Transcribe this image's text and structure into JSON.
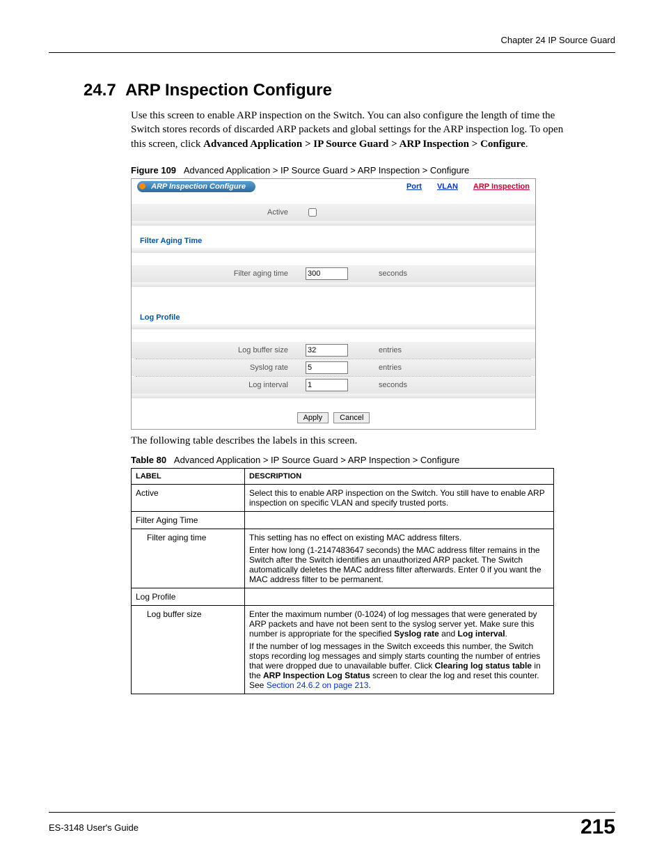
{
  "header": {
    "chapter": "Chapter 24 IP Source Guard"
  },
  "section": {
    "number": "24.7",
    "title": "ARP Inspection Configure",
    "intro_a": "Use this screen to enable ARP inspection on the Switch. You can also configure the length of time the Switch stores records of discarded ARP packets and global settings for the ARP inspection log. To open this screen, click ",
    "intro_bold": "Advanced Application > IP Source Guard > ARP Inspection > Configure",
    "intro_end": "."
  },
  "figure": {
    "label": "Figure 109",
    "caption": "Advanced Application > IP Source Guard > ARP Inspection > Configure"
  },
  "screenshot": {
    "title": "ARP Inspection Configure",
    "links": {
      "port": "Port",
      "vlan": "VLAN",
      "arp": "ARP Inspection"
    },
    "rows": {
      "active_label": "Active",
      "filter_section": "Filter Aging Time",
      "filter_aging_label": "Filter aging time",
      "filter_aging_value": "300",
      "filter_aging_unit": "seconds",
      "log_section": "Log Profile",
      "log_buffer_label": "Log buffer size",
      "log_buffer_value": "32",
      "log_buffer_unit": "entries",
      "syslog_rate_label": "Syslog rate",
      "syslog_rate_value": "5",
      "syslog_rate_unit": "entries",
      "log_interval_label": "Log interval",
      "log_interval_value": "1",
      "log_interval_unit": "seconds"
    },
    "buttons": {
      "apply": "Apply",
      "cancel": "Cancel"
    }
  },
  "post_figure_text": "The following table describes the labels in this screen.",
  "table": {
    "label": "Table 80",
    "caption": "Advanced Application > IP Source Guard > ARP Inspection > Configure",
    "head_label": "LABEL",
    "head_desc": "DESCRIPTION",
    "rows": {
      "active_label": "Active",
      "active_desc": "Select this to enable ARP inspection on the Switch. You still have to enable ARP inspection on specific VLAN and specify trusted ports.",
      "fat_label": "Filter Aging Time",
      "fat_desc": "",
      "fat2_label": "Filter aging time",
      "fat2_desc_a": "This setting has no effect on existing MAC address filters.",
      "fat2_desc_b": "Enter how long (1-2147483647 seconds) the MAC address filter remains in the Switch after the Switch identifies an unauthorized ARP packet. The Switch automatically deletes the MAC address filter afterwards. Enter 0 if you want the MAC address filter to be permanent.",
      "lp_label": "Log Profile",
      "lp_desc": "",
      "lbs_label": "Log buffer size",
      "lbs_desc_a1": "Enter the maximum number (0-1024) of log messages that were generated by ARP packets and have not been sent to the syslog server yet. Make sure this number is appropriate for the specified ",
      "lbs_desc_a_bold1": "Syslog rate",
      "lbs_desc_a_mid": " and ",
      "lbs_desc_a_bold2": "Log interval",
      "lbs_desc_a_end": ".",
      "lbs_desc_b1": "If the number of log messages in the Switch exceeds this number, the Switch stops recording log messages and simply starts counting the number of entries that were dropped due to unavailable buffer. Click ",
      "lbs_desc_b_bold1": "Clearing log status table",
      "lbs_desc_b_mid": " in the ",
      "lbs_desc_b_bold2": "ARP Inspection Log Status",
      "lbs_desc_b2": " screen to clear the log and reset this counter. See ",
      "lbs_desc_b_link": "Section 24.6.2 on page 213",
      "lbs_desc_b_end": "."
    }
  },
  "footer": {
    "guide": "ES-3148 User's Guide",
    "page": "215"
  }
}
